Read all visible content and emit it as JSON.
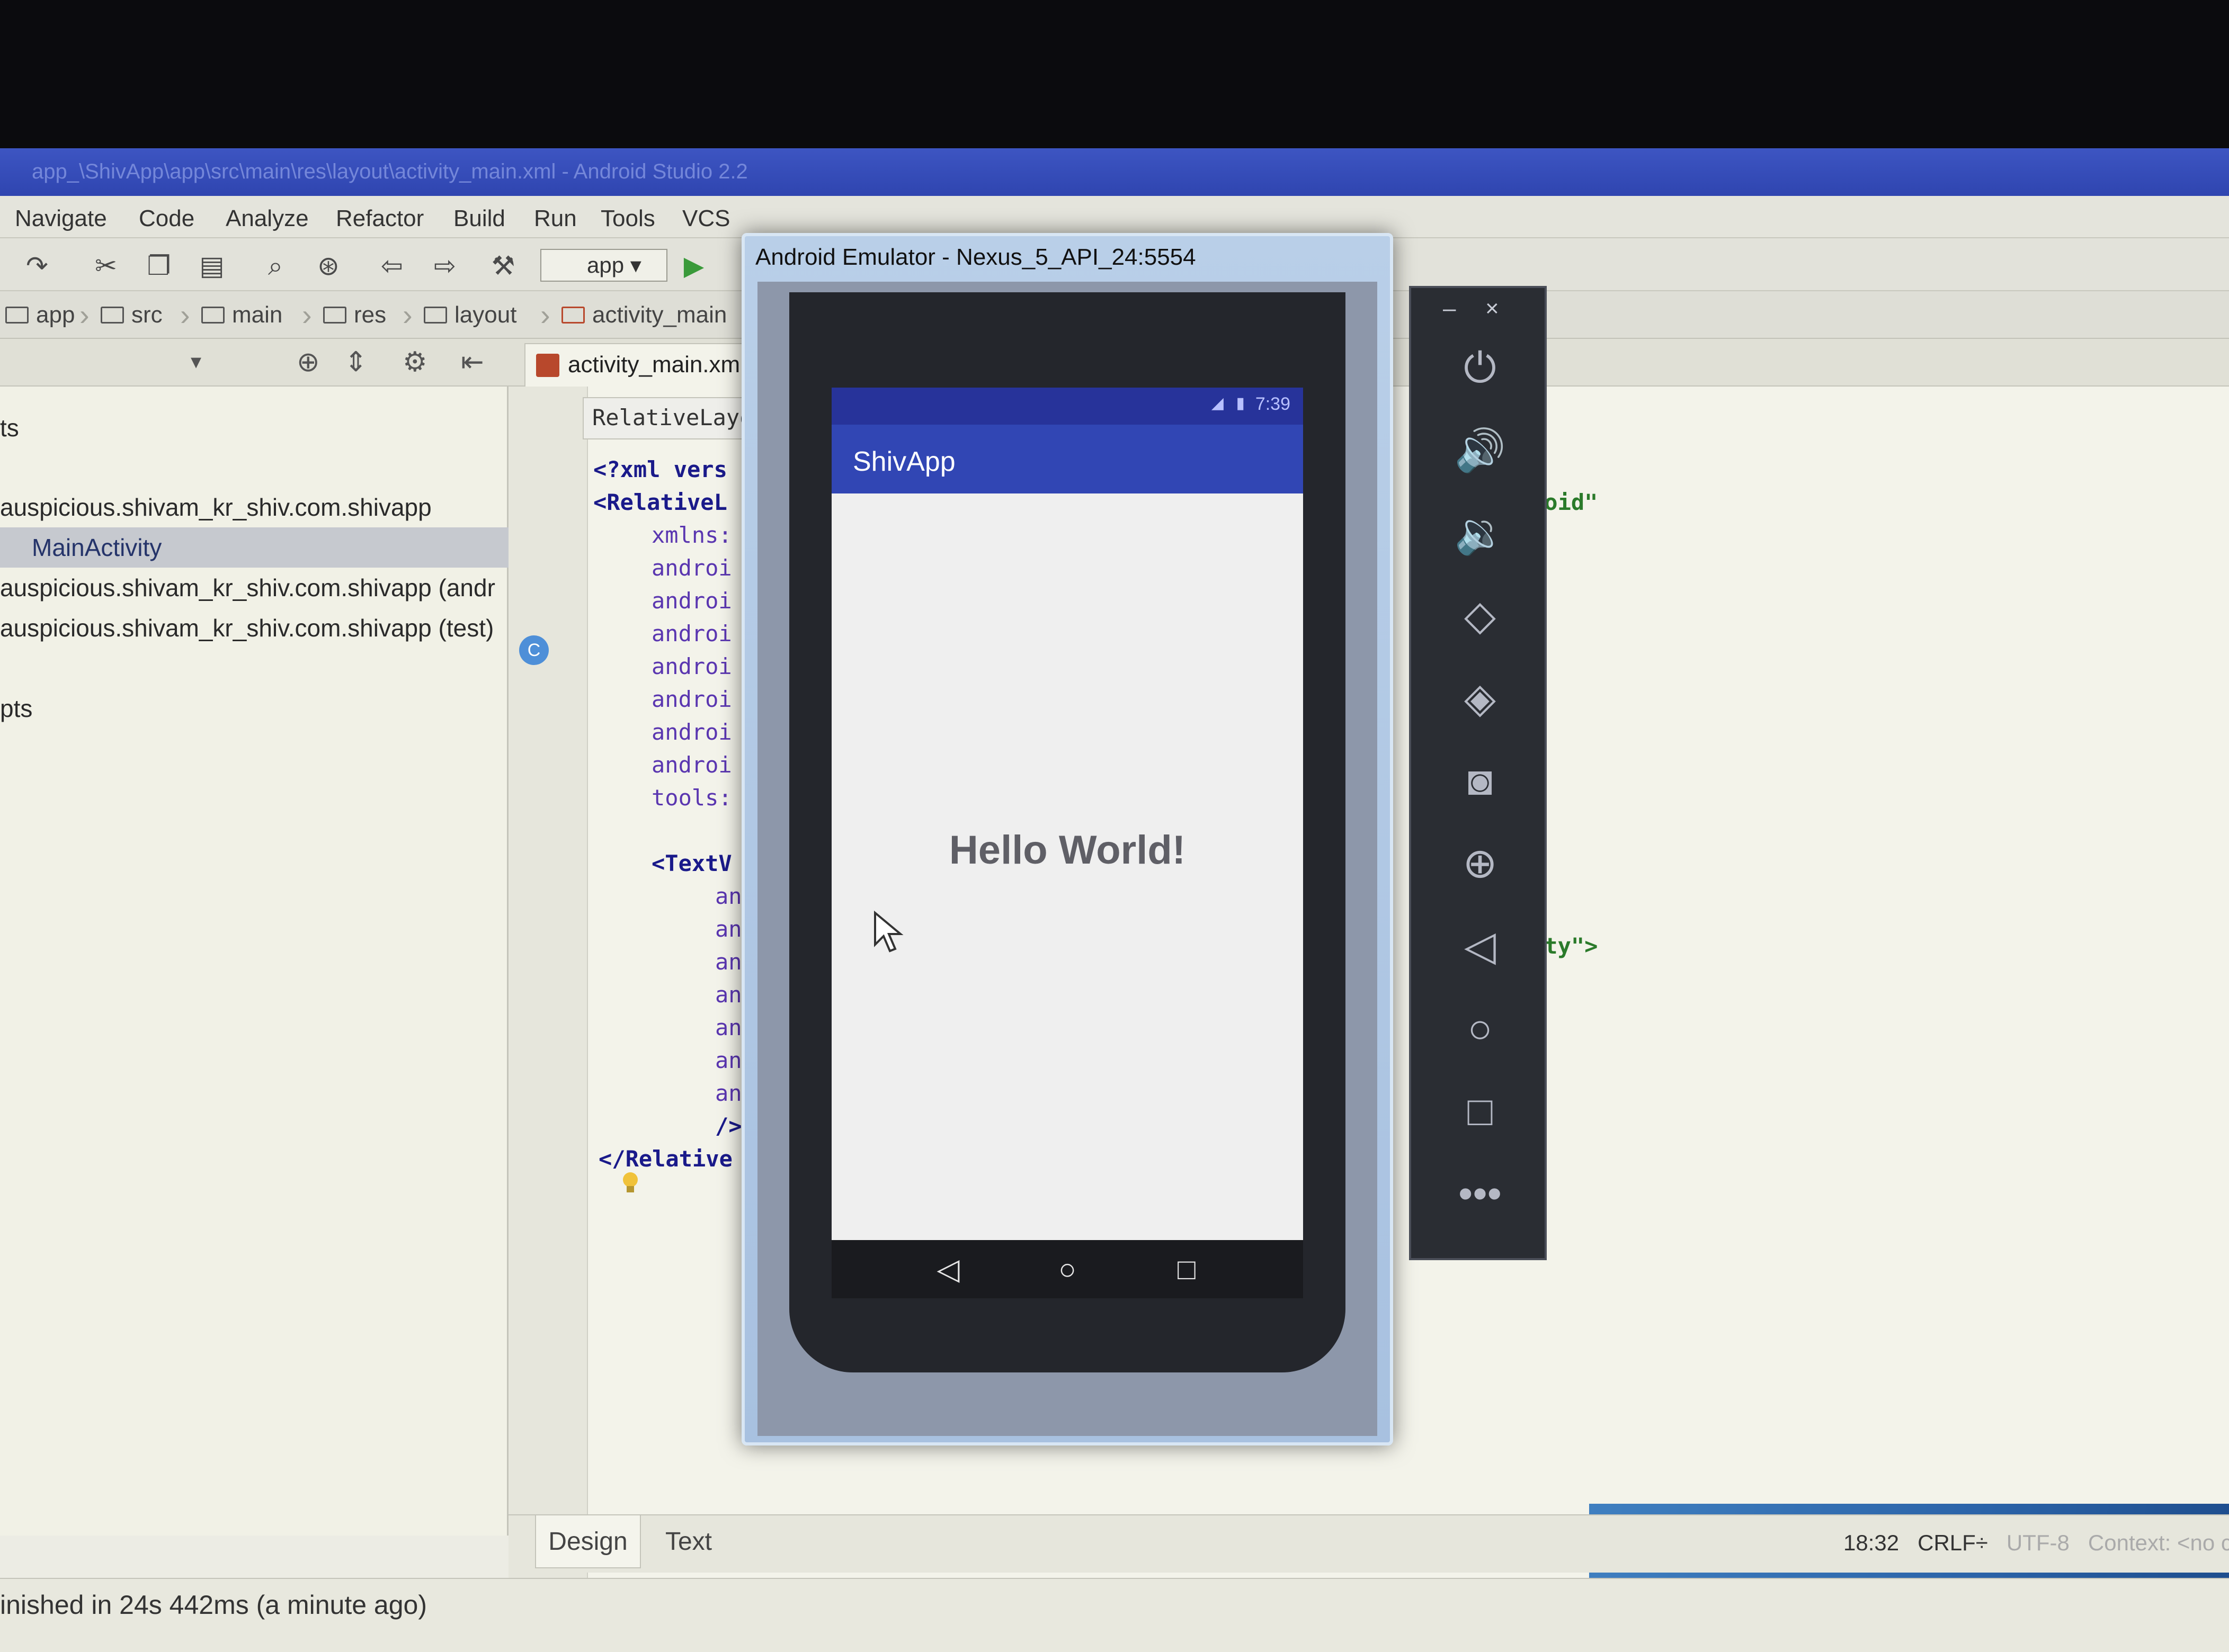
{
  "ide": {
    "title": "app_\\ShivApp\\app\\src\\main\\res\\layout\\activity_main.xml - Android Studio 2.2",
    "menu": [
      "Navigate",
      "Code",
      "Analyze",
      "Refactor",
      "Build",
      "Run",
      "Tools",
      "VCS"
    ],
    "run_config": "app",
    "breadcrumb": [
      "app",
      "src",
      "main",
      "res",
      "layout",
      "activity_main"
    ],
    "project_tree": [
      "ts",
      "auspicious.shivam_kr_shiv.com.shivapp",
      "MainActivity",
      "auspicious.shivam_kr_shiv.com.shivapp (andr",
      "auspicious.shivam_kr_shiv.com.shivapp (test)",
      "pts"
    ],
    "editor_tab": "activity_main.xml",
    "structure_label": "RelativeLayout",
    "code_lines": [
      "<?xml vers",
      "<RelativeL",
      "xmlns:",
      "androi",
      "androi",
      "androi",
      "androi",
      "androi",
      "androi",
      "androi",
      "tools:",
      "<TextV",
      "an",
      "an",
      "an",
      "an",
      "an",
      "an",
      "an",
      "/>",
      "</Relative"
    ],
    "code_right_1": "roid\"",
    "code_right_2": "ity\">",
    "bottom_tabs": [
      "Design",
      "Text"
    ],
    "status_message": "inished in 24s 442ms (a minute ago)",
    "status_position": "18:32",
    "status_line_sep": "CRLF÷",
    "status_encoding": "UTF-8",
    "status_context": "Context: <no co"
  },
  "emulator": {
    "window_title": "Android Emulator - Nexus_5_API_24:5554",
    "status_time": "7:39",
    "app_title": "ShivApp",
    "content_text": "Hello World!",
    "side_controls": [
      "power-icon",
      "volume-up-icon",
      "volume-down-icon",
      "rotate-left-icon",
      "rotate-right-icon",
      "camera-icon",
      "zoom-icon",
      "back-icon",
      "home-icon",
      "overview-icon",
      "more-icon"
    ],
    "window_controls": [
      "–",
      "×"
    ]
  },
  "colors": {
    "app_bar": "#3146b4",
    "status_strip": "#27339a",
    "ide_bg": "#ecece4",
    "selection": "#c6c9cf"
  }
}
